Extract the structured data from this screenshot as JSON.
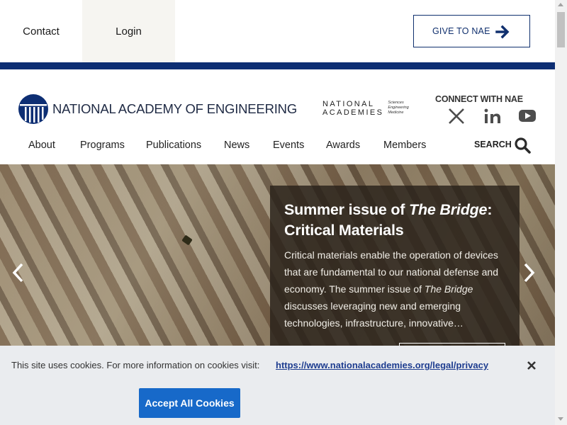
{
  "top_links": {
    "contact": "Contact",
    "login": "Login"
  },
  "give_button": {
    "label": "GIVE TO NAE",
    "icon": "arrow-right-icon"
  },
  "header": {
    "org_name": "NATIONAL ACADEMY OF ENGINEERING",
    "nas_logo": {
      "line1": "NATIONAL",
      "line2": "ACADEMIES",
      "sub1": "Sciences",
      "sub2": "Engineering",
      "sub3": "Medicine"
    },
    "connect_label": "CONNECT WITH NAE",
    "social_icons": [
      "x-icon",
      "linkedin-icon",
      "youtube-icon"
    ]
  },
  "nav": {
    "items": [
      "About",
      "Programs",
      "Publications",
      "News",
      "Events",
      "Awards",
      "Members"
    ],
    "search_label": "SEARCH"
  },
  "hero": {
    "title_prefix": "Summer issue of ",
    "title_italic": "The Bridge",
    "title_suffix": ": Critical Materials",
    "body_part1": "Critical materials enable the operation of devices that are fundamental to our national defense and economy. The summer issue of ",
    "body_italic": "The Bridge",
    "body_part2": " discusses leveraging new and emerging technologies, infrastructure, innovative…"
  },
  "cookie_banner": {
    "message": "This site uses cookies. For more information on cookies visit:",
    "link_text": "https://www.nationalacademies.org/legal/privacy",
    "accept_label": "Accept All Cookies"
  },
  "colors": {
    "brand_navy": "#0d2e73",
    "accept_blue": "#1769c9",
    "link_blue": "#1d3c8f"
  }
}
